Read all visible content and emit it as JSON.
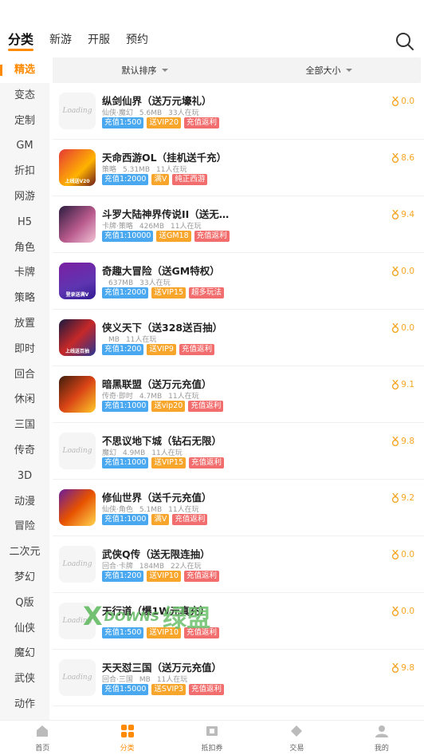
{
  "header": {
    "tabs": [
      {
        "label": "分类",
        "active": true
      },
      {
        "label": "新游",
        "active": false
      },
      {
        "label": "开服",
        "active": false
      },
      {
        "label": "预约",
        "active": false
      }
    ]
  },
  "sidebar": {
    "items": [
      "精选",
      "变态",
      "定制",
      "GM",
      "折扣",
      "网游",
      "H5",
      "角色",
      "卡牌",
      "策略",
      "放置",
      "即时",
      "回合",
      "休闲",
      "三国",
      "传奇",
      "3D",
      "动漫",
      "冒险",
      "二次元",
      "梦幻",
      "Q版",
      "仙侠",
      "魔幻",
      "武侠",
      "动作"
    ],
    "active_index": 0
  },
  "filters": {
    "sort_label": "默认排序",
    "size_label": "全部大小"
  },
  "games": [
    {
      "title": "纵剑仙界（送万元壕礼）",
      "category": "仙侠·魔幻",
      "size": "5.6MB",
      "players": "33人在玩",
      "tags": [
        [
          "充值1:500",
          "blue"
        ],
        [
          "送VIP20",
          "orange"
        ],
        [
          "充值返利",
          "red"
        ]
      ],
      "rating": "0.0",
      "icon": "placeholder",
      "icon_text": "Loading"
    },
    {
      "title": "天命西游OL（挂机送千充）",
      "category": "策略",
      "size": "5.31MB",
      "players": "11人在玩",
      "tags": [
        [
          "充值1:2000",
          "blue"
        ],
        [
          "满V",
          "orange"
        ],
        [
          "纯正西游",
          "red"
        ]
      ],
      "rating": "8.6",
      "icon": "g1",
      "icon_text": "上线送V20"
    },
    {
      "title": "斗罗大陆神界传说II（送无…",
      "category": "卡牌·策略",
      "size": "426MB",
      "players": "11人在玩",
      "tags": [
        [
          "充值1:10000",
          "blue"
        ],
        [
          "送GM18",
          "orange"
        ],
        [
          "充值返利",
          "red"
        ]
      ],
      "rating": "9.4",
      "icon": "g2",
      "icon_text": ""
    },
    {
      "title": "奇趣大冒险（送GM特权）",
      "category": "",
      "size": "637MB",
      "players": "33人在玩",
      "tags": [
        [
          "充值1:2000",
          "blue"
        ],
        [
          "送VIP15",
          "orange"
        ],
        [
          "超多玩法",
          "red"
        ]
      ],
      "rating": "0.0",
      "icon": "g3",
      "icon_text": "登录送满V"
    },
    {
      "title": "侠义天下（送328送百抽）",
      "category": "",
      "size": "MB",
      "players": "11人在玩",
      "tags": [
        [
          "充值1:200",
          "blue"
        ],
        [
          "送VIP9",
          "orange"
        ],
        [
          "充值返利",
          "red"
        ]
      ],
      "rating": "0.0",
      "icon": "g4",
      "icon_text": "上线送百抽"
    },
    {
      "title": "暗黑联盟（送万元充值）",
      "category": "传奇·即时",
      "size": "4.7MB",
      "players": "11人在玩",
      "tags": [
        [
          "充值1:1000",
          "blue"
        ],
        [
          "送vip20",
          "orange"
        ],
        [
          "充值返利",
          "red"
        ]
      ],
      "rating": "9.1",
      "icon": "g5",
      "icon_text": ""
    },
    {
      "title": "不思议地下城（钻石无限）",
      "category": "魔幻",
      "size": "4.9MB",
      "players": "11人在玩",
      "tags": [
        [
          "充值1:1000",
          "blue"
        ],
        [
          "送VIP15",
          "orange"
        ],
        [
          "充值返利",
          "red"
        ]
      ],
      "rating": "9.8",
      "icon": "placeholder",
      "icon_text": "Loading"
    },
    {
      "title": "修仙世界（送千元充值）",
      "category": "仙侠·角色",
      "size": "5.1MB",
      "players": "11人在玩",
      "tags": [
        [
          "充值1:1000",
          "blue"
        ],
        [
          "满V",
          "orange"
        ],
        [
          "充值返利",
          "red"
        ]
      ],
      "rating": "9.2",
      "icon": "g6",
      "icon_text": ""
    },
    {
      "title": "武侠Q传（送无限连抽）",
      "category": "回合·卡牌",
      "size": "184MB",
      "players": "22人在玩",
      "tags": [
        [
          "充值1:200",
          "blue"
        ],
        [
          "送VIP10",
          "orange"
        ],
        [
          "充值返利",
          "red"
        ]
      ],
      "rating": "0.0",
      "icon": "placeholder",
      "icon_text": "Loading"
    },
    {
      "title": "天行道（爆1W元真充）",
      "category": "",
      "size": "",
      "players": "",
      "tags": [
        [
          "充值1:500",
          "blue"
        ],
        [
          "送VIP10",
          "orange"
        ],
        [
          "充值返利",
          "red"
        ]
      ],
      "rating": "0.0",
      "icon": "placeholder",
      "icon_text": "Loading"
    },
    {
      "title": "天天怼三国（送万元充值）",
      "category": "回合·三国",
      "size": "MB",
      "players": "11人在玩",
      "tags": [
        [
          "充值1:5000",
          "blue"
        ],
        [
          "送SVIP3",
          "orange"
        ],
        [
          "充值返利",
          "red"
        ]
      ],
      "rating": "9.8",
      "icon": "placeholder",
      "icon_text": "Loading"
    }
  ],
  "watermark": {
    "x": "X",
    "text": "DOWNS",
    "cn": "绿盟"
  },
  "bottom_nav": [
    {
      "label": "首页",
      "icon": "home-icon",
      "active": false
    },
    {
      "label": "分类",
      "icon": "category-icon",
      "active": true
    },
    {
      "label": "抵扣券",
      "icon": "coupon-icon",
      "active": false
    },
    {
      "label": "交易",
      "icon": "trade-icon",
      "active": false
    },
    {
      "label": "我的",
      "icon": "user-icon",
      "active": false
    }
  ],
  "colors": {
    "accent": "#ff8a00",
    "tag_blue": "#4aa8f0",
    "tag_orange": "#f7a52b",
    "tag_red": "#f26d6d",
    "rating": "#f5a623"
  }
}
